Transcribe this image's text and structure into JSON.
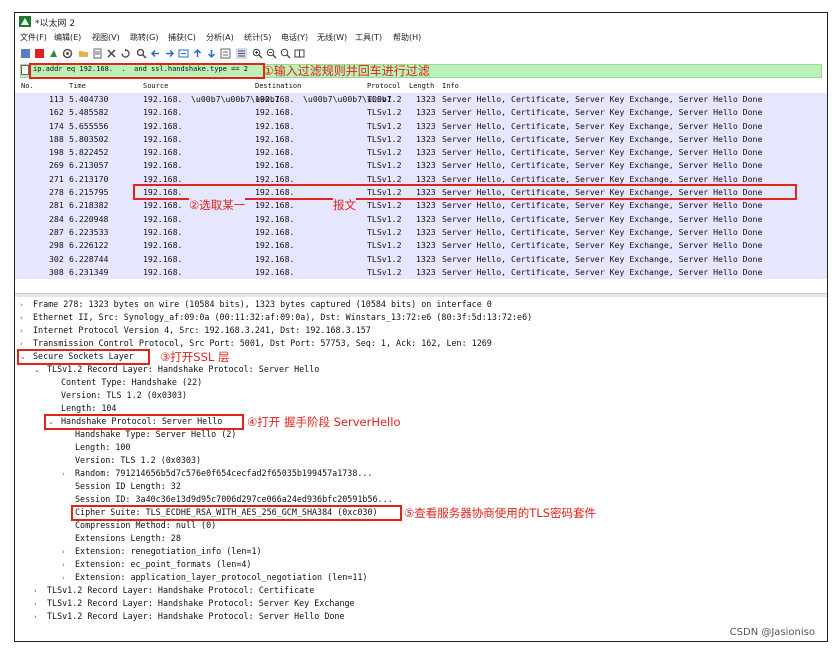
{
  "window": {
    "title": "*以太网 2"
  },
  "menu": [
    "文件(F)",
    "编辑(E)",
    "视图(V)",
    "跳转(G)",
    "捕获(C)",
    "分析(A)",
    "统计(S)",
    "电话(Y)",
    "无线(W)",
    "工具(T)",
    "帮助(H)"
  ],
  "filter": {
    "expression": "ip.addr eq 192.168.  .  and ssl.handshake.type == 2",
    "annotation": "①输入过滤规则并回车进行过滤"
  },
  "columns": [
    "No.",
    "Time",
    "Source",
    "Destination",
    "Protocol",
    "Length",
    "Info"
  ],
  "packets": [
    {
      "no": "113",
      "time": "5.404730",
      "src": "192.168.",
      "dst": "192.168.",
      "proto": "TLSv1.2",
      "len": "1323",
      "info": "Server Hello, Certificate, Server Key Exchange, Server Hello Done"
    },
    {
      "no": "162",
      "time": "5.485582",
      "src": "192.168.",
      "dst": "192.168.",
      "proto": "TLSv1.2",
      "len": "1323",
      "info": "Server Hello, Certificate, Server Key Exchange, Server Hello Done"
    },
    {
      "no": "174",
      "time": "5.655556",
      "src": "192.168.",
      "dst": "192.168.",
      "proto": "TLSv1.2",
      "len": "1323",
      "info": "Server Hello, Certificate, Server Key Exchange, Server Hello Done"
    },
    {
      "no": "188",
      "time": "5.803502",
      "src": "192.168.",
      "dst": "192.168.",
      "proto": "TLSv1.2",
      "len": "1323",
      "info": "Server Hello, Certificate, Server Key Exchange, Server Hello Done"
    },
    {
      "no": "198",
      "time": "5.822452",
      "src": "192.168.",
      "dst": "192.168.",
      "proto": "TLSv1.2",
      "len": "1323",
      "info": "Server Hello, Certificate, Server Key Exchange, Server Hello Done"
    },
    {
      "no": "269",
      "time": "6.213057",
      "src": "192.168.",
      "dst": "192.168.",
      "proto": "TLSv1.2",
      "len": "1323",
      "info": "Server Hello, Certificate, Server Key Exchange, Server Hello Done"
    },
    {
      "no": "271",
      "time": "6.213170",
      "src": "192.168.",
      "dst": "192.168.",
      "proto": "TLSv1.2",
      "len": "1323",
      "info": "Server Hello, Certificate, Server Key Exchange, Server Hello Done"
    },
    {
      "no": "278",
      "time": "6.215795",
      "src": "192.168.",
      "dst": "192.168.",
      "proto": "TLSv1.2",
      "len": "1323",
      "info": "Server Hello, Certificate, Server Key Exchange, Server Hello Done"
    },
    {
      "no": "281",
      "time": "6.218382",
      "src": "192.168.",
      "dst": "192.168.",
      "proto": "TLSv1.2",
      "len": "1323",
      "info": "Server Hello, Certificate, Server Key Exchange, Server Hello Done"
    },
    {
      "no": "284",
      "time": "6.220948",
      "src": "192.168.",
      "dst": "192.168.",
      "proto": "TLSv1.2",
      "len": "1323",
      "info": "Server Hello, Certificate, Server Key Exchange, Server Hello Done"
    },
    {
      "no": "287",
      "time": "6.223533",
      "src": "192.168.",
      "dst": "192.168.",
      "proto": "TLSv1.2",
      "len": "1323",
      "info": "Server Hello, Certificate, Server Key Exchange, Server Hello Done"
    },
    {
      "no": "298",
      "time": "6.226122",
      "src": "192.168.",
      "dst": "192.168.",
      "proto": "TLSv1.2",
      "len": "1323",
      "info": "Server Hello, Certificate, Server Key Exchange, Server Hello Done"
    },
    {
      "no": "302",
      "time": "6.228744",
      "src": "192.168.",
      "dst": "192.168.",
      "proto": "TLSv1.2",
      "len": "1323",
      "info": "Server Hello, Certificate, Server Key Exchange, Server Hello Done"
    },
    {
      "no": "308",
      "time": "6.231349",
      "src": "192.168.",
      "dst": "192.168.",
      "proto": "TLSv1.2",
      "len": "1323",
      "info": "Server Hello, Certificate, Server Key Exchange, Server Hello Done"
    }
  ],
  "annotation_select": "②选取某一",
  "annotation_select_tail": "报文",
  "details": {
    "frame": "Frame 278: 1323 bytes on wire (10584 bits), 1323 bytes captured (10584 bits) on interface 0",
    "ethernet": "Ethernet II, Src: Synology_af:09:0a (00:11:32:af:09:0a), Dst: Winstars_13:72:e6 (80:3f:5d:13:72:e6)",
    "ip": "Internet Protocol Version 4, Src: 192.168.3.241, Dst: 192.168.3.157",
    "tcp": "Transmission Control Protocol, Src Port: 5001, Dst Port: 57753, Seq: 1, Ack: 162, Len: 1269",
    "ssl": "Secure Sockets Layer",
    "ssl_annotation": "③打开SSL 层",
    "record": "TLSv1.2 Record Layer: Handshake Protocol: Server Hello",
    "content_type": "Content Type: Handshake (22)",
    "version": "Version: TLS 1.2 (0x0303)",
    "length": "Length: 104",
    "handshake": "Handshake Protocol: Server Hello",
    "handshake_annotation": "④打开 握手阶段 ServerHello",
    "hs_type": "Handshake Type: Server Hello (2)",
    "hs_length": "Length: 100",
    "hs_version": "Version: TLS 1.2 (0x0303)",
    "random": "Random: 791214656b5d7c576e0f654cecfad2f65035b199457a1738...",
    "sid_len": "Session ID Length: 32",
    "sid": "Session ID: 3a40c36e13d9d95c7006d297ce066a24ed936bfc20591b56...",
    "cipher": "Cipher Suite: TLS_ECDHE_RSA_WITH_AES_256_GCM_SHA384 (0xc030)",
    "cipher_annotation": "⑤查看服务器协商使用的TLS密码套件",
    "compression": "Compression Method: null (0)",
    "ext_len": "Extensions Length: 28",
    "ext1": "Extension: renegotiation_info (len=1)",
    "ext2": "Extension: ec_point_formats (len=4)",
    "ext3": "Extension: application_layer_protocol_negotiation (len=11)",
    "rec2": "TLSv1.2 Record Layer: Handshake Protocol: Certificate",
    "rec3": "TLSv1.2 Record Layer: Handshake Protocol: Server Key Exchange",
    "rec4": "TLSv1.2 Record Layer: Handshake Protocol: Server Hello Done"
  },
  "watermark": "CSDN @Jasioniso",
  "colors": {
    "row_bg": "#e7e6ff",
    "filter_bg": "#b9f1b6",
    "annotation": "#e0241b"
  }
}
